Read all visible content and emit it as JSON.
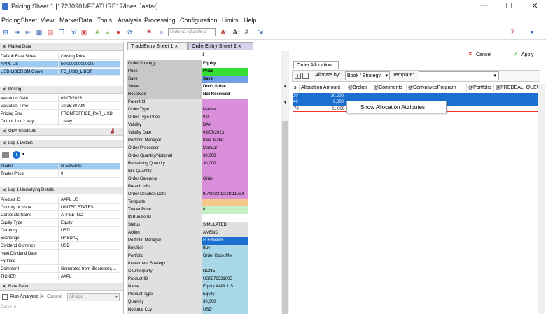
{
  "window": {
    "title": "Pricing Sheet 1 [17230901/FEATURE17/Ines Jaafar]"
  },
  "menu": [
    "PricingSheet",
    "View",
    "MarketData",
    "Tools",
    "Analysis",
    "Processing",
    "Configuration",
    "Limits",
    "Help"
  ],
  "toolbar": {
    "search_placeholder": "Order Id / Bundle Id"
  },
  "left": {
    "market_data": {
      "title": "Market Data",
      "rows": [
        [
          "Default Rate Sides",
          "Closing Price"
        ],
        [
          "AAPL US",
          "50.000000000000"
        ],
        [
          "USD LIBOR 3M Curve",
          "FO_USD_LIBOR"
        ]
      ]
    },
    "pricing": {
      "title": "Pricing",
      "rows": [
        [
          "Valuation Date",
          "09/07/2023"
        ],
        [
          "Valuation Time",
          "10:25:30 AM"
        ],
        [
          "Pricing Env",
          "FRONTOFFICE_PAR_USD"
        ],
        [
          "Output 1 or 2 way",
          "1-way"
        ]
      ]
    },
    "oda": {
      "title": "ODA Shortcuts"
    },
    "leg1": {
      "title": "Leg 1 Details",
      "rows": [
        [
          "Trader",
          "G Edwards"
        ],
        [
          "Trader Price",
          "0"
        ]
      ]
    },
    "underlying": {
      "title": "Leg 1 Underlying Details",
      "rows": [
        [
          "Product ID",
          "AAPL US"
        ],
        [
          "Country of Issue",
          "UNITED STATES"
        ],
        [
          "Corporate Name",
          "APPLE INC"
        ],
        [
          "Equity Type",
          "Equity"
        ],
        [
          "Currency",
          "USD"
        ],
        [
          "Exchange",
          "NASDAQ"
        ],
        [
          "Dividend Currency",
          "USD"
        ],
        [
          "Next Dividend Date",
          ""
        ],
        [
          "Ex Date",
          ""
        ],
        [
          "Comment",
          "Generated from Bloomberg ..."
        ],
        [
          "TICKER",
          "AAPL"
        ]
      ]
    },
    "rate_delta": {
      "title": "Rate Delta",
      "run_analysis": "Run Analysis",
      "cancel": "Cancel",
      "all_legs": "All legs",
      "curve": "Curve"
    }
  },
  "tabs": [
    {
      "label": "TradeEntry Sheet",
      "num": "1"
    },
    {
      "label": "OrderEntry Sheet",
      "num": "2"
    }
  ],
  "grid_header": "1",
  "grid": [
    [
      "Order Strategy",
      "Equity",
      "#c8c8c8",
      "#ffffff"
    ],
    [
      "Price",
      "Price",
      "#c8c8c8",
      "#33dd33"
    ],
    [
      "Save",
      "Save",
      "#c8c8c8",
      "#6fa0e6"
    ],
    [
      "Solve",
      "Don't Solve",
      "#c8c8c8",
      "#ffffff"
    ],
    [
      "Reserved",
      "Not Reserved",
      "#c8c8c8",
      "#ffffff"
    ],
    [
      "Parent Id",
      "",
      "#e0e0e0",
      "#d98fd9"
    ],
    [
      "Order Type",
      "Market",
      "#e0e0e0",
      "#d98fd9"
    ],
    [
      "Order Type Price",
      "0.0",
      "#e0e0e0",
      "#d98fd9"
    ],
    [
      "Validity",
      "DAY",
      "#e0e0e0",
      "#d98fd9"
    ],
    [
      "Validity Date",
      "09/07/2023",
      "#e0e0e0",
      "#d98fd9"
    ],
    [
      "Portfolio Manager",
      "Ines Jaafar",
      "#e0e0e0",
      "#d98fd9"
    ],
    [
      "Order Processor",
      "Manual",
      "#e0e0e0",
      "#d98fd9"
    ],
    [
      "Order Quantity/Notional",
      "30,000",
      "#e0e0e0",
      "#d98fd9"
    ],
    [
      "Remaining Quantity",
      "30,000",
      "#e0e0e0",
      "#d98fd9"
    ],
    [
      "Idle Quantity",
      "",
      "#e0e0e0",
      "#d98fd9"
    ],
    [
      "Order Category",
      "Order",
      "#e0e0e0",
      "#d98fd9"
    ],
    [
      "Breach Info",
      "",
      "#e0e0e0",
      "#d98fd9"
    ],
    [
      "Order Creation Date",
      "9/7/2023 10:28:11 AM",
      "#e0e0e0",
      "#d98fd9"
    ],
    [
      "Template",
      "",
      "#e0e0e0",
      "#f5c98a"
    ],
    [
      "Trader Price",
      "0",
      "#e0e0e0",
      "#c5f0c5"
    ],
    [
      "⊞ Bundle ID",
      "",
      "#e0e0e0",
      "#ffffff"
    ],
    [
      "Status",
      "SIMULATED",
      "#e0e0e0",
      "#e0e0e0"
    ],
    [
      "Action",
      "AMEND",
      "#e0e0e0",
      "#e0e0e0"
    ],
    [
      "Portfolio Manager",
      "G Edwards",
      "#e0e0e0",
      "#1a6fd1"
    ],
    [
      "Buy/Sell",
      "Buy",
      "#e0e0e0",
      "#a8d8e8"
    ],
    [
      "Portfolio",
      "Order Book MM",
      "#e0e0e0",
      "#a8d8e8"
    ],
    [
      "Investment Strategy",
      "",
      "#e0e0e0",
      "#a8d8e8"
    ],
    [
      "Counterparty",
      "NONE",
      "#e0e0e0",
      "#a8d8e8"
    ],
    [
      "Product ID",
      "US0378331005",
      "#e0e0e0",
      "#a8d8e8"
    ],
    [
      "Name",
      "Equity AAPL US",
      "#e0e0e0",
      "#a8d8e8"
    ],
    [
      "Product Type",
      "Equity",
      "#e0e0e0",
      "#a8d8e8"
    ],
    [
      "Quantity",
      "30,000",
      "#e0e0e0",
      "#a8d8e8"
    ],
    [
      "Notional Ccy",
      "USD",
      "#e0e0e0",
      "#a8d8e8"
    ]
  ],
  "allocation": {
    "cancel": "Cancel",
    "apply": "Apply",
    "tab": "Order Allocation",
    "allocate_by_label": "Allocate by:",
    "allocate_by_value": "Book / Strategy",
    "template_label": "Template:",
    "columns": [
      "s",
      "Allocation Amount",
      "@Broker",
      "@Comments",
      "@DerivativesProgram",
      "@Portfolio",
      "@PREDEAL_QUEUE"
    ],
    "rows": [
      {
        "id": "30",
        "amount": "30,000"
      },
      {
        "id": "40",
        "amount": "9,000"
      },
      {
        "id": "70",
        "amount": "21,000"
      }
    ],
    "context_menu": "Show Allocation Attributes"
  }
}
